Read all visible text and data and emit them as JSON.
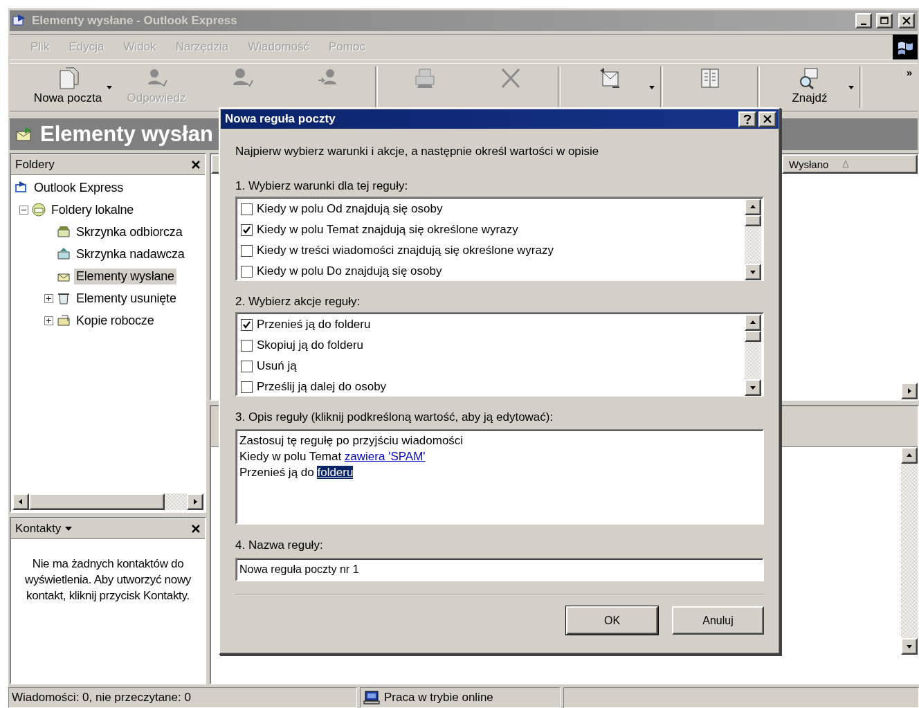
{
  "window": {
    "title": "Elementy wysłane - Outlook Express",
    "active": false
  },
  "menu": [
    {
      "label": "Plik",
      "disabled": true
    },
    {
      "label": "Edycja",
      "disabled": true
    },
    {
      "label": "Widok",
      "disabled": true
    },
    {
      "label": "Narzędzia",
      "disabled": true
    },
    {
      "label": "Wiadomość",
      "disabled": true
    },
    {
      "label": "Pomoc",
      "disabled": true
    }
  ],
  "toolbar": [
    {
      "kind": "new-mail",
      "label": "Nowa poczta",
      "disabled": false,
      "dropdown": true
    },
    {
      "kind": "reply",
      "label": "Odpowiedz",
      "disabled": true,
      "dropdown": false
    },
    {
      "kind": "reply-all",
      "disabled": true,
      "dropdown": false
    },
    {
      "kind": "forward",
      "disabled": true,
      "dropdown": false
    },
    {
      "kind": "print",
      "disabled": true,
      "dropdown": false
    },
    {
      "kind": "delete",
      "disabled": true,
      "dropdown": false
    },
    {
      "kind": "send-receive",
      "disabled": false,
      "dropdown": true
    },
    {
      "kind": "addresses",
      "disabled": false,
      "dropdown": false
    },
    {
      "kind": "find",
      "label": "Znajdź",
      "disabled": false,
      "dropdown": true
    }
  ],
  "toolbar_overflow": "»",
  "folder_header": {
    "title": "Elementy wysłan"
  },
  "folders_pane": {
    "title": "Foldery",
    "tree": [
      {
        "label": "Outlook Express",
        "kind": "root",
        "selected": false,
        "children": [
          {
            "label": "Foldery lokalne",
            "kind": "local",
            "selected": false,
            "expanded": true,
            "children": [
              {
                "label": "Skrzynka odbiorcza",
                "kind": "inbox",
                "selected": false
              },
              {
                "label": "Skrzynka nadawcza",
                "kind": "outbox",
                "selected": false
              },
              {
                "label": "Elementy wysłane",
                "kind": "sent",
                "selected": true
              },
              {
                "label": "Elementy usunięte",
                "kind": "deleted",
                "selected": false,
                "expanded": false
              },
              {
                "label": "Kopie robocze",
                "kind": "drafts",
                "selected": false,
                "expanded": false
              }
            ]
          }
        ]
      }
    ]
  },
  "contacts_pane": {
    "title": "Kontakty",
    "message": "Nie ma żadnych kontaktów do wyświetlenia. Aby utworzyć nowy kontakt, kliknij przycisk Kontakty."
  },
  "message_list": {
    "columns": [
      "Wysłano"
    ]
  },
  "status_bar": [
    "Wiadomości: 0, nie przeczytane: 0",
    "Praca w trybie online"
  ],
  "dialog": {
    "title": "Nowa reguła poczty",
    "intro": "Najpierw wybierz warunki i akcje, a następnie określ wartości w opisie",
    "conditions_label": "1. Wybierz warunki dla tej reguły:",
    "conditions": [
      {
        "label": "Kiedy w polu Od znajdują się osoby",
        "checked": false
      },
      {
        "label": "Kiedy w polu Temat znajdują się określone wyrazy",
        "checked": true
      },
      {
        "label": "Kiedy w treści wiadomości znajdują się określone wyrazy",
        "checked": false
      },
      {
        "label": "Kiedy w polu Do znajdują się osoby",
        "checked": false
      }
    ],
    "actions_label": "2. Wybierz akcje reguły:",
    "actions": [
      {
        "label": "Przenieś ją do folderu",
        "checked": true
      },
      {
        "label": "Skopiuj ją do folderu",
        "checked": false
      },
      {
        "label": "Usuń ją",
        "checked": false
      },
      {
        "label": "Prześlij ją dalej do osoby",
        "checked": false
      }
    ],
    "description_label": "3. Opis reguły (kliknij podkreśloną wartość, aby ją edytować):",
    "description": [
      {
        "parts": [
          {
            "text": "Zastosuj tę regułę po przyjściu wiadomości",
            "link": false
          }
        ]
      },
      {
        "parts": [
          {
            "text": "Kiedy w polu Temat ",
            "link": false
          },
          {
            "text": "zawiera 'SPAM'",
            "link": true,
            "selected": false
          }
        ]
      },
      {
        "parts": [
          {
            "text": "Przenieś ją do ",
            "link": false
          },
          {
            "text": "folderu",
            "link": true,
            "selected": true
          }
        ]
      }
    ],
    "name_label": "4. Nazwa reguły:",
    "name_value": "Nowa reguła poczty nr 1",
    "buttons": [
      {
        "label": "OK",
        "default": true
      },
      {
        "label": "Anuluj",
        "default": false
      }
    ]
  }
}
